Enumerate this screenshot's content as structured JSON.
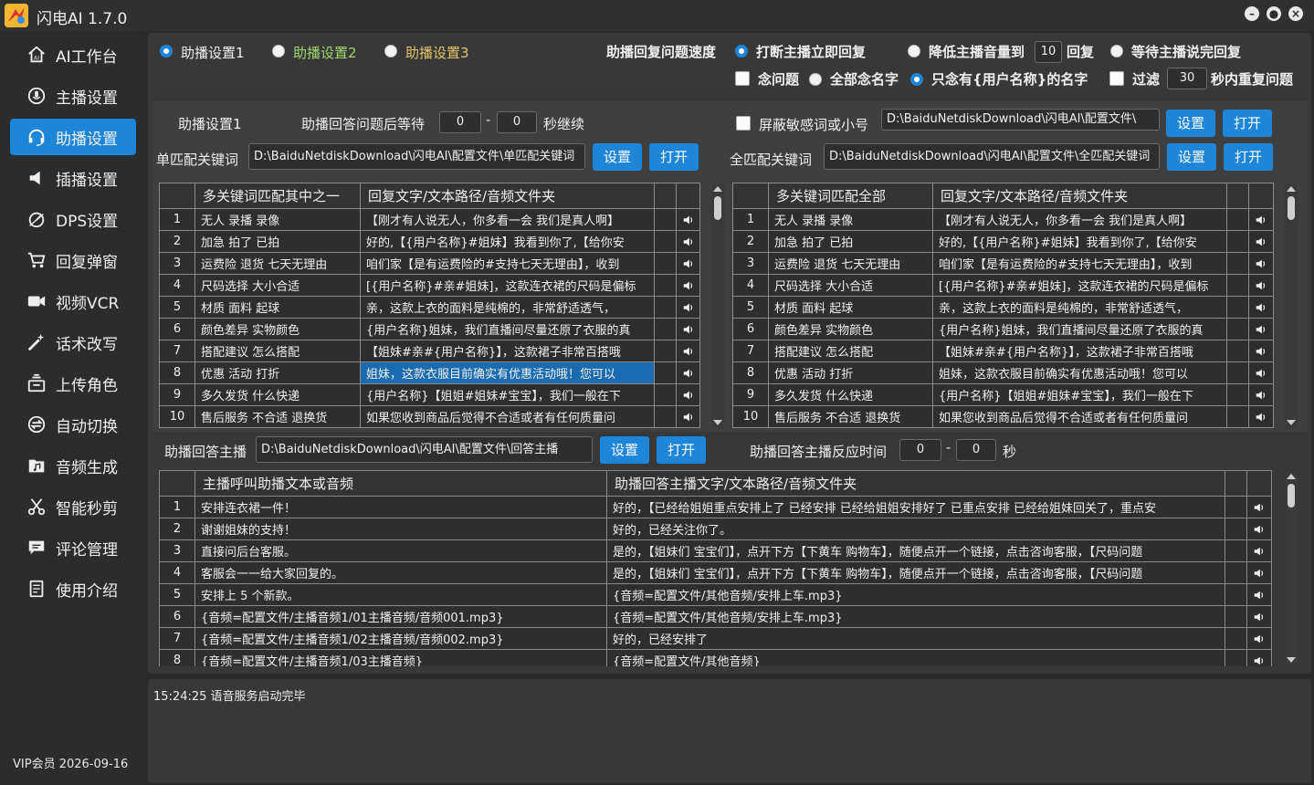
{
  "app": {
    "title": "闪电AI 1.7.0"
  },
  "window": {
    "min": "–",
    "max": "●",
    "close": "×"
  },
  "sidebar": {
    "items": [
      {
        "label": "AI工作台",
        "icon": "home-icon"
      },
      {
        "label": "主播设置",
        "icon": "anchor-icon"
      },
      {
        "label": "助播设置",
        "icon": "headset-icon",
        "active": true
      },
      {
        "label": "插播设置",
        "icon": "speaker-icon"
      },
      {
        "label": "DPS设置",
        "icon": "gauge-icon"
      },
      {
        "label": "回复弹窗",
        "icon": "cart-icon"
      },
      {
        "label": "视频VCR",
        "icon": "video-camera-icon"
      },
      {
        "label": "话术改写",
        "icon": "magic-wand-icon"
      },
      {
        "label": "上传角色",
        "icon": "upload-box-icon"
      },
      {
        "label": "自动切换",
        "icon": "switch-icon"
      },
      {
        "label": "音频生成",
        "icon": "music-folder-icon"
      },
      {
        "label": "智能秒剪",
        "icon": "scissors-icon"
      },
      {
        "label": "评论管理",
        "icon": "comment-icon"
      },
      {
        "label": "使用介绍",
        "icon": "document-icon"
      }
    ],
    "vip": "VIP会员  2026-09-16"
  },
  "top": {
    "tabs": [
      "助播设置1",
      "助播设置2",
      "助播设置3"
    ],
    "speed_label": "助播回复问题速度",
    "opt_interrupt": "打断主播立即回复",
    "opt_lower": "降低主播音量到",
    "lower_value": "10",
    "opt_lower_suffix": "回复",
    "opt_wait": "等待主播说完回复",
    "read_question": "念问题",
    "read_all": "全部念名字",
    "read_only": "只念有{用户名称}的名字",
    "filter": "过滤",
    "filter_value": "30",
    "filter_suffix": "秒内重复问题"
  },
  "settings": {
    "title": "助播设置1",
    "wait_label": "助播回答问题后等待",
    "wait_min": "0",
    "dash": "-",
    "wait_max": "0",
    "wait_suffix": "秒继续",
    "block_label": "屏蔽敏感词或小号",
    "block_path": "D:\\BaiduNetdiskDownload\\闪电AI\\配置文件\\",
    "set_btn": "设置",
    "open_btn": "打开",
    "single_label": "单匹配关键词",
    "single_path": "D:\\BaiduNetdiskDownload\\闪电AI\\配置文件\\单匹配关键词",
    "full_label": "全匹配关键词",
    "full_path": "D:\\BaiduNetdiskDownload\\闪电AI\\配置文件\\全匹配关键词"
  },
  "left_table": {
    "headers": [
      "多关键词匹配其中之一",
      "回复文字/文本路径/音频文件夹"
    ],
    "rows": [
      {
        "n": "1",
        "kw": "无人 录播 录像",
        "reply": "【刚才有人说无人，你多看一会  我们是真人啊】"
      },
      {
        "n": "2",
        "kw": "加急 拍了 已拍",
        "reply": "好的,【{用户名称}#姐妹】我看到你了,【给你安"
      },
      {
        "n": "3",
        "kw": "运费险 退货 七天无理由",
        "reply": "咱们家【是有运费险的#支持七天无理由】，收到"
      },
      {
        "n": "4",
        "kw": "尺码选择 大小合适",
        "reply": "[{用户名称}#亲#姐妹]，这款连衣裙的尺码是偏标"
      },
      {
        "n": "5",
        "kw": "材质 面料 起球",
        "reply": "亲，这款上衣的面料是纯棉的，非常舒适透气，"
      },
      {
        "n": "6",
        "kw": "颜色差异 实物颜色",
        "reply": "{用户名称}姐妹，我们直播间尽量还原了衣服的真"
      },
      {
        "n": "7",
        "kw": "搭配建议 怎么搭配",
        "reply": "【姐妹#亲#{用户名称}】，这款裙子非常百搭哦"
      },
      {
        "n": "8",
        "kw": "优惠 活动 打折",
        "reply": "姐妹，这款衣服目前确实有优惠活动哦！您可以"
      },
      {
        "n": "9",
        "kw": "多久发货 什么快递",
        "reply": "{用户名称}【姐姐#姐妹#宝宝】，我们一般在下"
      },
      {
        "n": "10",
        "kw": "售后服务 不合适 退换货",
        "reply": "如果您收到商品后觉得不合适或者有任何质量问"
      }
    ]
  },
  "right_table": {
    "headers": [
      "多关键词匹配全部",
      "回复文字/文本路径/音频文件夹"
    ],
    "rows": [
      {
        "n": "1",
        "kw": "无人 录播 录像",
        "reply": "【刚才有人说无人，你多看一会  我们是真人啊】"
      },
      {
        "n": "2",
        "kw": "加急 拍了 已拍",
        "reply": "好的,【{用户名称}#姐妹】我看到你了,【给你安"
      },
      {
        "n": "3",
        "kw": "运费险 退货 七天无理由",
        "reply": "咱们家【是有运费险的#支持七天无理由】，收到"
      },
      {
        "n": "4",
        "kw": "尺码选择 大小合适",
        "reply": "[{用户名称}#亲#姐妹]，这款连衣裙的尺码是偏标"
      },
      {
        "n": "5",
        "kw": "材质 面料 起球",
        "reply": "亲，这款上衣的面料是纯棉的，非常舒适透气，"
      },
      {
        "n": "6",
        "kw": "颜色差异 实物颜色",
        "reply": "{用户名称}姐妹，我们直播间尽量还原了衣服的真"
      },
      {
        "n": "7",
        "kw": "搭配建议 怎么搭配",
        "reply": "【姐妹#亲#{用户名称}】，这款裙子非常百搭哦"
      },
      {
        "n": "8",
        "kw": "优惠 活动 打折",
        "reply": "姐妹，这款衣服目前确实有优惠活动哦！您可以"
      },
      {
        "n": "9",
        "kw": "多久发货 什么快递",
        "reply": "{用户名称}【姐姐#姐妹#宝宝】，我们一般在下"
      },
      {
        "n": "10",
        "kw": "售后服务 不合适 退换货",
        "reply": "如果您收到商品后觉得不合适或者有任何质量问"
      }
    ]
  },
  "answer": {
    "label": "助播回答主播",
    "path": "D:\\BaiduNetdiskDownload\\闪电AI\\配置文件\\回答主播",
    "react_label": "助播回答主播反应时间",
    "react_min": "0",
    "react_max": "0",
    "react_suffix": "秒"
  },
  "bottom_table": {
    "headers": [
      "主播呼叫助播文本或音频",
      "助播回答主播文字/文本路径/音频文件夹"
    ],
    "rows": [
      {
        "n": "1",
        "call": "安排连衣裙一件！",
        "reply": "好的，【已经给姐姐重点安排上了 已经安排 已经给姐姐安排好了 已重点安排 已经给姐妹回关了，重点安"
      },
      {
        "n": "2",
        "call": "谢谢姐妹的支持！",
        "reply": "好的，已经关注你了。"
      },
      {
        "n": "3",
        "call": "直接问后台客服。",
        "reply": "是的，【姐妹们 宝宝们】，点开下方【下黄车 购物车】，随便点开一个链接，点击咨询客服，【尺码问题"
      },
      {
        "n": "4",
        "call": "客服会一一给大家回复的。",
        "reply": "是的，【姐妹们 宝宝们】，点开下方【下黄车 购物车】，随便点开一个链接，点击咨询客服，【尺码问题"
      },
      {
        "n": "5",
        "call": "安排上 5 个新款。",
        "reply": "{音频=配置文件/其他音频/安排上车.mp3}"
      },
      {
        "n": "6",
        "call": "{音频=配置文件/主播音频1/01主播音频/音频001.mp3}",
        "reply": "{音频=配置文件/其他音频/安排上车.mp3}"
      },
      {
        "n": "7",
        "call": "{音频=配置文件/主播音频1/02主播音频/音频002.mp3}",
        "reply": "好的，已经安排了"
      },
      {
        "n": "8",
        "call": "{音频=配置文件/主播音频1/03主播音频}",
        "reply": "{音频=配置文件/其他音频}"
      }
    ]
  },
  "log": {
    "line": "15:24:25 语音服务启动完毕"
  },
  "colors": {
    "accent": "#1e86d9",
    "panel": "#383838",
    "background": "#2b2b2b"
  }
}
